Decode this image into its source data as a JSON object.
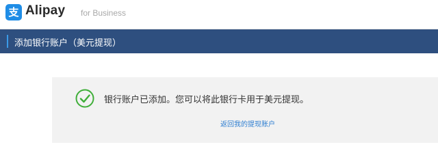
{
  "header": {
    "logo_glyph": "支",
    "brand": "Alipay",
    "sub": "for Business"
  },
  "title_bar": {
    "title": "添加银行账户（美元提现）"
  },
  "result": {
    "icon": "check-circle-icon",
    "message": "银行账户已添加。您可以将此银行卡用于美元提现。",
    "link_label": "返回我的提现账户"
  },
  "colors": {
    "brand_blue": "#1f8de6",
    "title_bar_bg": "#2e4f7f",
    "success_green": "#3fae39",
    "link": "#2f7fd1"
  }
}
